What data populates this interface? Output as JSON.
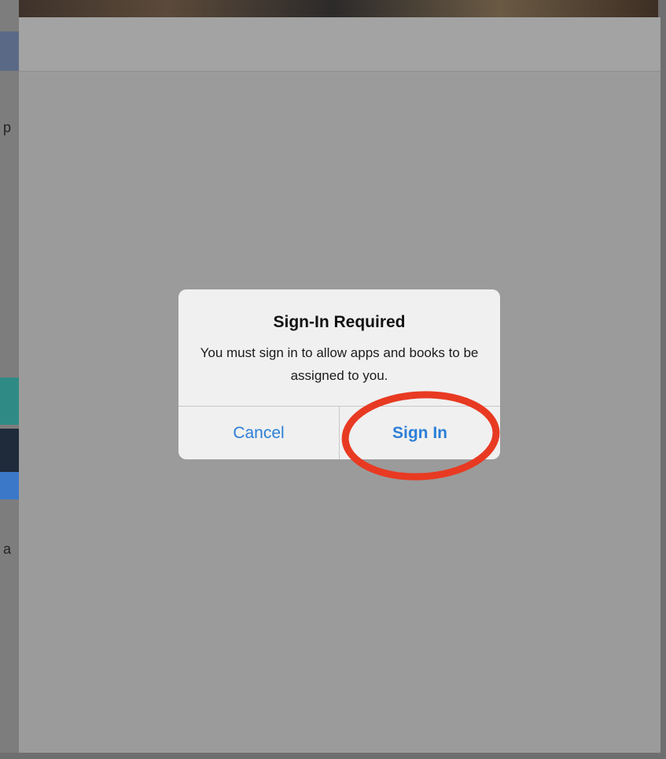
{
  "background": {
    "side_letters": [
      "p",
      "a"
    ]
  },
  "alert": {
    "title": "Sign-In Required",
    "message": "You must sign in to allow apps and books to be assigned to you.",
    "buttons": {
      "cancel": "Cancel",
      "sign_in": "Sign In"
    }
  },
  "colors": {
    "accent": "#2c7fd6",
    "highlight": "#e83a22",
    "overlay": "#9b9b9b"
  }
}
